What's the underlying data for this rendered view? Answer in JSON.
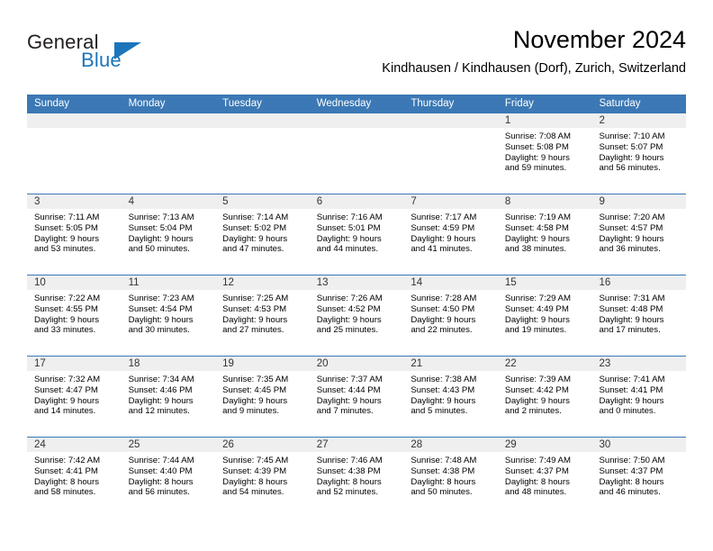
{
  "brand": {
    "word1": "General",
    "word2": "Blue",
    "triangle_icon": "triangle-icon",
    "color_dark": "#231f20",
    "color_blue": "#1b75bb"
  },
  "header": {
    "title": "November 2024",
    "subtitle": "Kindhausen / Kindhausen (Dorf), Zurich, Switzerland"
  },
  "theme": {
    "header_blue": "#3b78b5",
    "day_band_gray": "#efefef",
    "text": "#000000"
  },
  "calendar": {
    "weekday_headers": [
      "Sunday",
      "Monday",
      "Tuesday",
      "Wednesday",
      "Thursday",
      "Friday",
      "Saturday"
    ],
    "weeks": [
      [
        {
          "day": "",
          "lines": []
        },
        {
          "day": "",
          "lines": []
        },
        {
          "day": "",
          "lines": []
        },
        {
          "day": "",
          "lines": []
        },
        {
          "day": "",
          "lines": []
        },
        {
          "day": "1",
          "lines": [
            "Sunrise: 7:08 AM",
            "Sunset: 5:08 PM",
            "Daylight: 9 hours",
            "and 59 minutes."
          ]
        },
        {
          "day": "2",
          "lines": [
            "Sunrise: 7:10 AM",
            "Sunset: 5:07 PM",
            "Daylight: 9 hours",
            "and 56 minutes."
          ]
        }
      ],
      [
        {
          "day": "3",
          "lines": [
            "Sunrise: 7:11 AM",
            "Sunset: 5:05 PM",
            "Daylight: 9 hours",
            "and 53 minutes."
          ]
        },
        {
          "day": "4",
          "lines": [
            "Sunrise: 7:13 AM",
            "Sunset: 5:04 PM",
            "Daylight: 9 hours",
            "and 50 minutes."
          ]
        },
        {
          "day": "5",
          "lines": [
            "Sunrise: 7:14 AM",
            "Sunset: 5:02 PM",
            "Daylight: 9 hours",
            "and 47 minutes."
          ]
        },
        {
          "day": "6",
          "lines": [
            "Sunrise: 7:16 AM",
            "Sunset: 5:01 PM",
            "Daylight: 9 hours",
            "and 44 minutes."
          ]
        },
        {
          "day": "7",
          "lines": [
            "Sunrise: 7:17 AM",
            "Sunset: 4:59 PM",
            "Daylight: 9 hours",
            "and 41 minutes."
          ]
        },
        {
          "day": "8",
          "lines": [
            "Sunrise: 7:19 AM",
            "Sunset: 4:58 PM",
            "Daylight: 9 hours",
            "and 38 minutes."
          ]
        },
        {
          "day": "9",
          "lines": [
            "Sunrise: 7:20 AM",
            "Sunset: 4:57 PM",
            "Daylight: 9 hours",
            "and 36 minutes."
          ]
        }
      ],
      [
        {
          "day": "10",
          "lines": [
            "Sunrise: 7:22 AM",
            "Sunset: 4:55 PM",
            "Daylight: 9 hours",
            "and 33 minutes."
          ]
        },
        {
          "day": "11",
          "lines": [
            "Sunrise: 7:23 AM",
            "Sunset: 4:54 PM",
            "Daylight: 9 hours",
            "and 30 minutes."
          ]
        },
        {
          "day": "12",
          "lines": [
            "Sunrise: 7:25 AM",
            "Sunset: 4:53 PM",
            "Daylight: 9 hours",
            "and 27 minutes."
          ]
        },
        {
          "day": "13",
          "lines": [
            "Sunrise: 7:26 AM",
            "Sunset: 4:52 PM",
            "Daylight: 9 hours",
            "and 25 minutes."
          ]
        },
        {
          "day": "14",
          "lines": [
            "Sunrise: 7:28 AM",
            "Sunset: 4:50 PM",
            "Daylight: 9 hours",
            "and 22 minutes."
          ]
        },
        {
          "day": "15",
          "lines": [
            "Sunrise: 7:29 AM",
            "Sunset: 4:49 PM",
            "Daylight: 9 hours",
            "and 19 minutes."
          ]
        },
        {
          "day": "16",
          "lines": [
            "Sunrise: 7:31 AM",
            "Sunset: 4:48 PM",
            "Daylight: 9 hours",
            "and 17 minutes."
          ]
        }
      ],
      [
        {
          "day": "17",
          "lines": [
            "Sunrise: 7:32 AM",
            "Sunset: 4:47 PM",
            "Daylight: 9 hours",
            "and 14 minutes."
          ]
        },
        {
          "day": "18",
          "lines": [
            "Sunrise: 7:34 AM",
            "Sunset: 4:46 PM",
            "Daylight: 9 hours",
            "and 12 minutes."
          ]
        },
        {
          "day": "19",
          "lines": [
            "Sunrise: 7:35 AM",
            "Sunset: 4:45 PM",
            "Daylight: 9 hours",
            "and 9 minutes."
          ]
        },
        {
          "day": "20",
          "lines": [
            "Sunrise: 7:37 AM",
            "Sunset: 4:44 PM",
            "Daylight: 9 hours",
            "and 7 minutes."
          ]
        },
        {
          "day": "21",
          "lines": [
            "Sunrise: 7:38 AM",
            "Sunset: 4:43 PM",
            "Daylight: 9 hours",
            "and 5 minutes."
          ]
        },
        {
          "day": "22",
          "lines": [
            "Sunrise: 7:39 AM",
            "Sunset: 4:42 PM",
            "Daylight: 9 hours",
            "and 2 minutes."
          ]
        },
        {
          "day": "23",
          "lines": [
            "Sunrise: 7:41 AM",
            "Sunset: 4:41 PM",
            "Daylight: 9 hours",
            "and 0 minutes."
          ]
        }
      ],
      [
        {
          "day": "24",
          "lines": [
            "Sunrise: 7:42 AM",
            "Sunset: 4:41 PM",
            "Daylight: 8 hours",
            "and 58 minutes."
          ]
        },
        {
          "day": "25",
          "lines": [
            "Sunrise: 7:44 AM",
            "Sunset: 4:40 PM",
            "Daylight: 8 hours",
            "and 56 minutes."
          ]
        },
        {
          "day": "26",
          "lines": [
            "Sunrise: 7:45 AM",
            "Sunset: 4:39 PM",
            "Daylight: 8 hours",
            "and 54 minutes."
          ]
        },
        {
          "day": "27",
          "lines": [
            "Sunrise: 7:46 AM",
            "Sunset: 4:38 PM",
            "Daylight: 8 hours",
            "and 52 minutes."
          ]
        },
        {
          "day": "28",
          "lines": [
            "Sunrise: 7:48 AM",
            "Sunset: 4:38 PM",
            "Daylight: 8 hours",
            "and 50 minutes."
          ]
        },
        {
          "day": "29",
          "lines": [
            "Sunrise: 7:49 AM",
            "Sunset: 4:37 PM",
            "Daylight: 8 hours",
            "and 48 minutes."
          ]
        },
        {
          "day": "30",
          "lines": [
            "Sunrise: 7:50 AM",
            "Sunset: 4:37 PM",
            "Daylight: 8 hours",
            "and 46 minutes."
          ]
        }
      ]
    ]
  }
}
